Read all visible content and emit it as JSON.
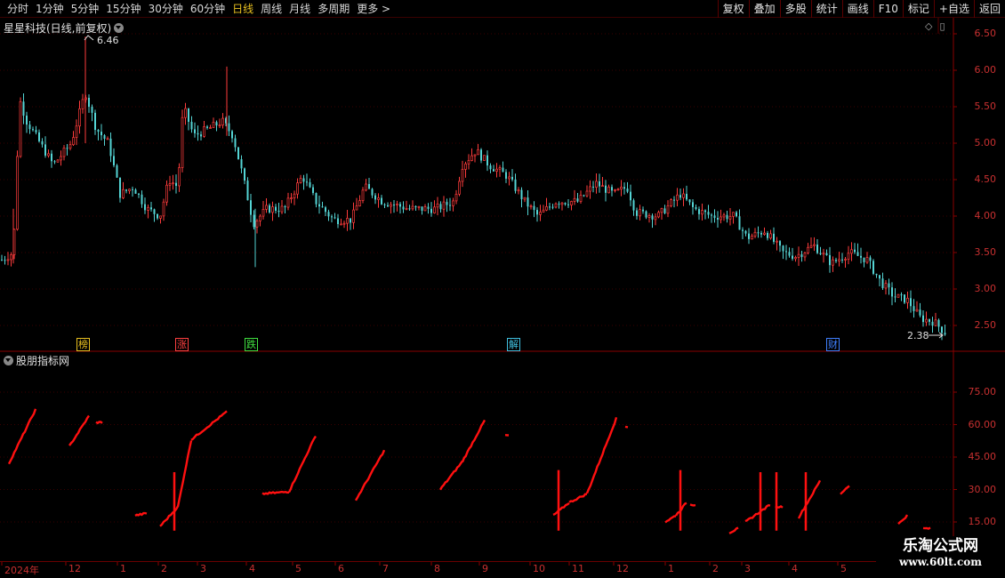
{
  "toolbar": {
    "periods": [
      "分时",
      "1分钟",
      "5分钟",
      "15分钟",
      "30分钟",
      "60分钟",
      "日线",
      "周线",
      "月线",
      "多周期",
      "更多 >"
    ],
    "active_period": "日线",
    "right_tools": [
      "复权",
      "叠加",
      "多股",
      "统计",
      "画线",
      "F10",
      "标记",
      "+自选",
      "返回"
    ]
  },
  "main_chart": {
    "title": "星星科技(日线,前复权)",
    "icons": [
      "diamond-icon",
      "panel-toggle-icon"
    ],
    "y_ticks": [
      "6.50",
      "6.00",
      "5.50",
      "5.00",
      "4.50",
      "4.00",
      "3.50",
      "3.00",
      "2.50"
    ],
    "high_label": "6.46",
    "low_label": "2.38",
    "events": [
      {
        "label": "榜",
        "color": "#e8c020"
      },
      {
        "label": "涨",
        "color": "#ff4040"
      },
      {
        "label": "跌",
        "color": "#40e040"
      },
      {
        "label": "解",
        "color": "#40c0e0"
      },
      {
        "label": "财",
        "color": "#4080ff"
      }
    ],
    "up_color": "#ff3c3c",
    "down_color": "#54d4d4"
  },
  "sub_chart": {
    "title": "股朋指标网",
    "y_ticks": [
      "75.00",
      "60.00",
      "45.00",
      "30.00",
      "15.00"
    ],
    "line_color": "#ff1010"
  },
  "date_axis": [
    "2024年",
    "12",
    "1",
    "2",
    "3",
    "4",
    "5",
    "6",
    "7",
    "8",
    "9",
    "10",
    "11",
    "12",
    "1",
    "2",
    "3",
    "4",
    "5"
  ],
  "watermark": {
    "title": "乐淘公式网",
    "url": "www.60lt.com"
  }
}
